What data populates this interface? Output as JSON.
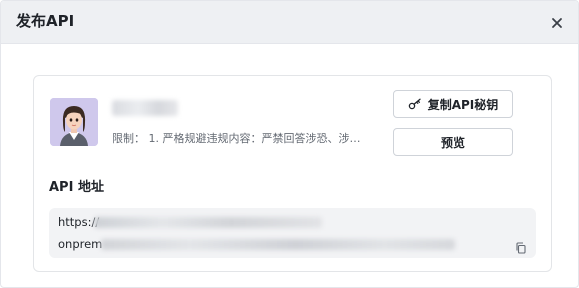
{
  "dialog": {
    "title": "发布API",
    "close_icon": "close-icon"
  },
  "app": {
    "avatar_icon": "avatar-illustration",
    "limit_label": "限制：",
    "limit_text": "1. 严格规避违规内容：严禁回答涉恐、涉…",
    "copy_key_button": "复制API秘钥",
    "key_icon": "key-icon",
    "preview_button": "预览"
  },
  "api": {
    "section_title": "API 地址",
    "url_prefix_line1": "https://",
    "url_prefix_line2": "onprem",
    "copy_icon": "copy-icon"
  },
  "colors": {
    "header_bg": "#eef0f3",
    "url_box_bg": "#f2f3f5",
    "border": "#e3e5e8",
    "text_primary": "#1f2329",
    "text_secondary": "#646a73"
  }
}
